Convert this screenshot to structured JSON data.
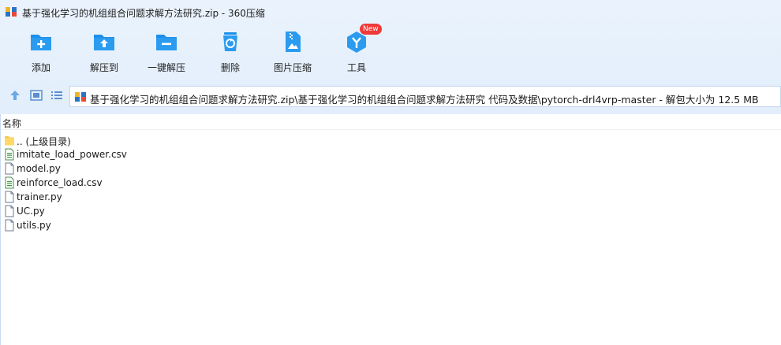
{
  "window": {
    "title": "基于强化学习的机组组合问题求解方法研究.zip - 360压缩"
  },
  "toolbar": {
    "add": "添加",
    "extract_to": "解压到",
    "one_click_extract": "一键解压",
    "delete": "删除",
    "image_compress": "图片压缩",
    "tools": "工具",
    "tools_badge": "New"
  },
  "navbar": {
    "address": "基于强化学习的机组组合问题求解方法研究.zip\\基于强化学习的机组组合问题求解方法研究 代码及数据\\pytorch-drl4vrp-master - 解包大小为 12.5 MB"
  },
  "list": {
    "column_name": "名称",
    "items": [
      {
        "name": ".. (上级目录)",
        "icon": "folder-icon"
      },
      {
        "name": "imitate_load_power.csv",
        "icon": "csv-file-icon"
      },
      {
        "name": "model.py",
        "icon": "file-icon"
      },
      {
        "name": "reinforce_load.csv",
        "icon": "csv-file-icon"
      },
      {
        "name": "trainer.py",
        "icon": "file-icon"
      },
      {
        "name": "UC.py",
        "icon": "file-icon"
      },
      {
        "name": "utils.py",
        "icon": "file-icon"
      }
    ]
  },
  "colors": {
    "accent": "#1c8fea",
    "toolbar_bg": "#e6f0fc",
    "badge": "#f03a3a"
  }
}
